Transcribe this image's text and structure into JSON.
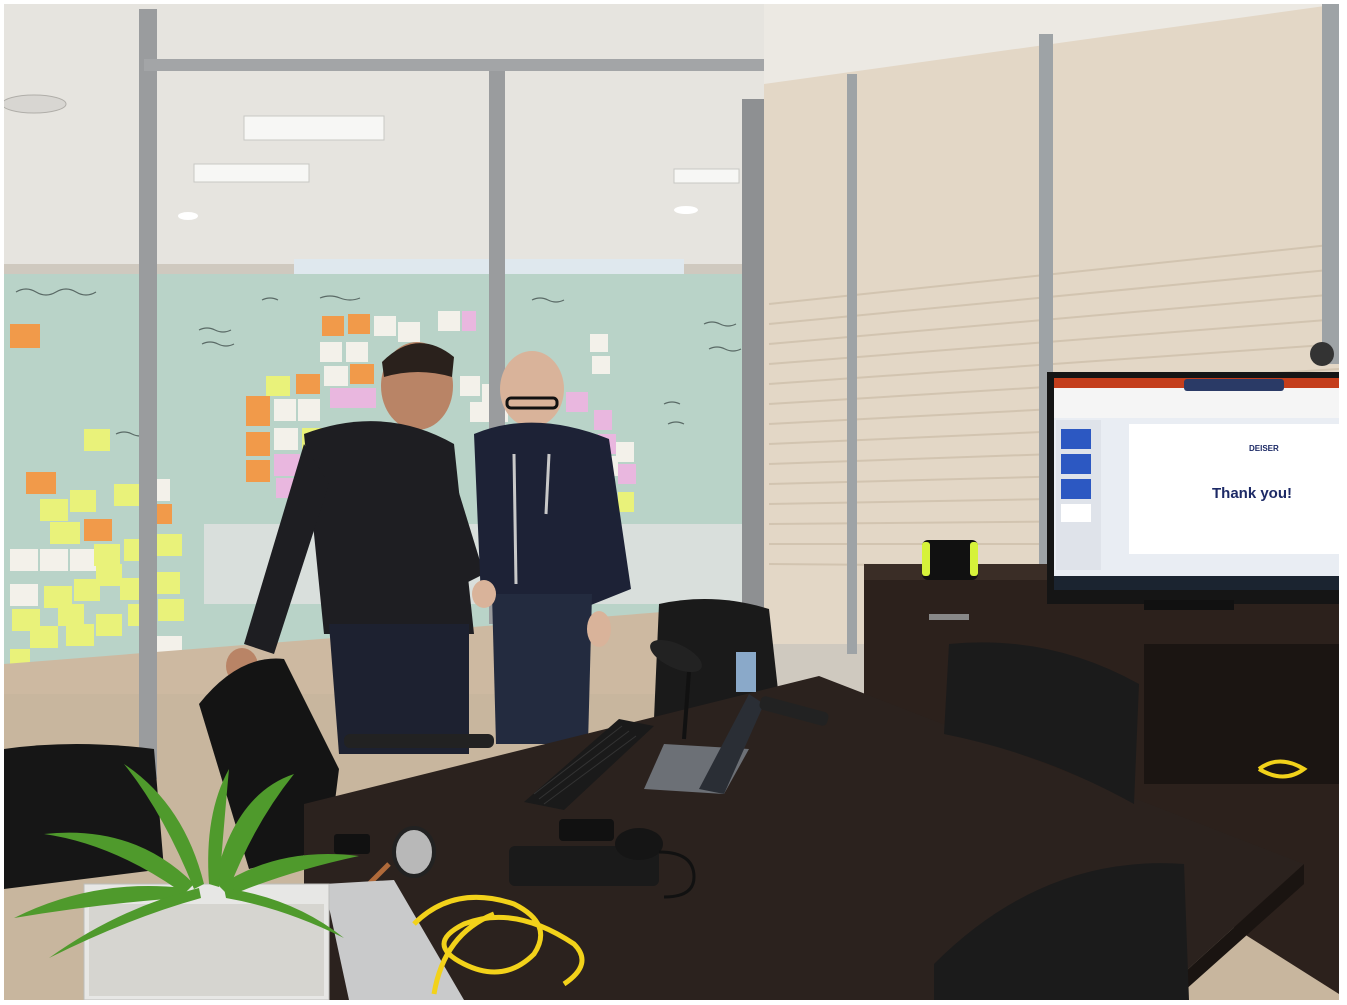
{
  "scene": {
    "colors": {
      "ceiling": "#ece9e3",
      "wall": "#e3d7c6",
      "glass": "#b9d3c8",
      "table": "#2b221e",
      "floor": "#cdb9a1",
      "frame": "#9a9c9e",
      "sticky_yellow": "#e9f27a",
      "sticky_orange": "#f19a4a",
      "sticky_pink": "#e9b7df",
      "sticky_white": "#f3f1ea",
      "plant": "#4f9a2c",
      "cable": "#f2d21a",
      "tv_frame": "#151515",
      "ppt_red": "#c43e1c"
    }
  },
  "tv_slide": {
    "logo_text": "DEISER",
    "heading": "Thank you!"
  }
}
